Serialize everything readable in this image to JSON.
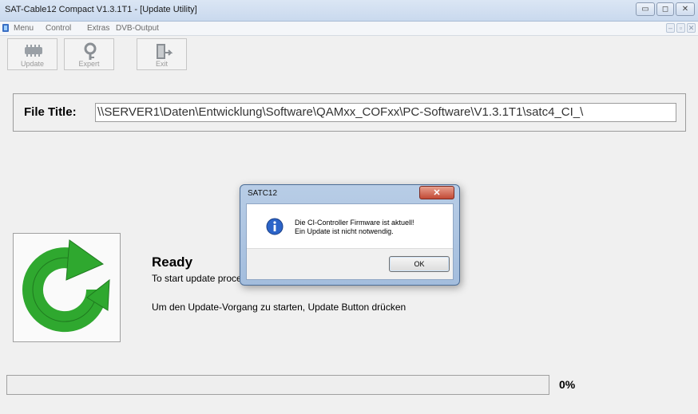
{
  "window": {
    "title": "SAT-Cable12 Compact V1.3.1T1 - [Update Utility]",
    "minimize_glyph": "▭",
    "maximize_glyph": "◻",
    "close_glyph": "✕"
  },
  "menu": {
    "items": [
      "Menu",
      "Control",
      "Extras",
      "DVB-Output"
    ],
    "mdi_minimize": "–",
    "mdi_restore": "▫",
    "mdi_close": "✕"
  },
  "toolbar": {
    "update_label": "Update",
    "expert_label": "Expert",
    "exit_label": "Exit"
  },
  "file": {
    "label": "File Title:",
    "path": "\\\\SERVER1\\Daten\\Entwicklung\\Software\\QAMxx_COFxx\\PC-Software\\V1.3.1T1\\satc4_CI_\\"
  },
  "status": {
    "title": "Ready",
    "line_en": "To start update process, press Update button",
    "line_de": "Um den Update-Vorgang zu starten, Update Button drücken"
  },
  "progress": {
    "value": 0,
    "percent_text": "0%"
  },
  "dialog": {
    "title": "SATC12",
    "close_glyph": "✕",
    "message_line1": "Die CI-Controller Firmware ist aktuell!",
    "message_line2": "Ein Update ist nicht notwendig.",
    "ok_label": "OK"
  },
  "colors": {
    "refresh_arrow": "#2fa82f",
    "dialog_frame": "#a3bddd"
  }
}
